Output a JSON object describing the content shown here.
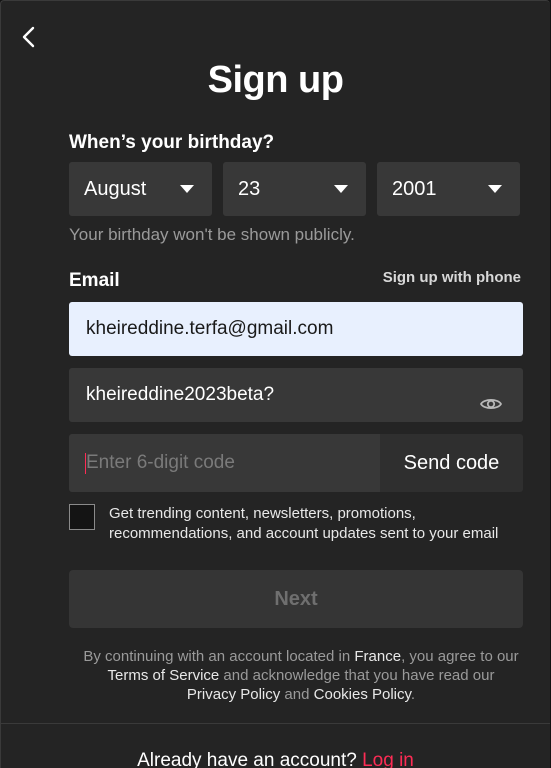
{
  "page": {
    "title": "Sign up",
    "back_icon": "chevron-left-icon"
  },
  "birthday": {
    "label": "When’s your birthday?",
    "month": "August",
    "day": "23",
    "year": "2001",
    "hint": "Your birthday won't be shown publicly."
  },
  "email": {
    "label": "Email",
    "phone_link": "Sign up with phone",
    "value": "kheireddine.terfa@gmail.com"
  },
  "password": {
    "value": "kheireddine2023beta?",
    "toggle_icon": "eye-icon"
  },
  "code": {
    "placeholder": "Enter 6-digit code",
    "send_label": "Send code"
  },
  "marketing": {
    "text": "Get trending content, newsletters, promotions, recommendations, and account updates sent to your email",
    "checked": false
  },
  "next_button": "Next",
  "legal": {
    "part1": "By continuing with an account located in ",
    "country": "France",
    "part2": ", you agree to our ",
    "terms": "Terms of Service",
    "part3": " and acknowledge that you have read our ",
    "privacy": "Privacy Policy",
    "part4": " and ",
    "cookies": "Cookies Policy",
    "part5": "."
  },
  "footer": {
    "text": "Already have an account? ",
    "login": "Log in"
  },
  "colors": {
    "background": "#242424",
    "field": "#383838",
    "accent": "#fe2c55",
    "autofill": "#e8f0fe"
  }
}
